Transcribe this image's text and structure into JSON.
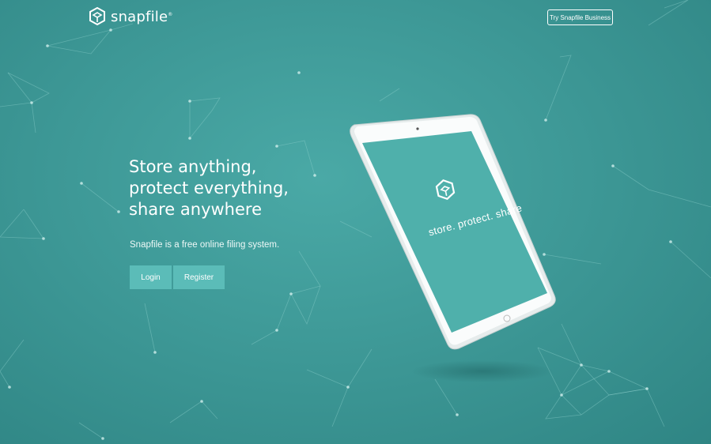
{
  "brand": {
    "name": "snapfile",
    "mark": "®"
  },
  "header": {
    "business_button": "Try Snapfile Business"
  },
  "hero": {
    "headline": [
      "Store anything,",
      "protect everything,",
      "share anywhere"
    ],
    "subtitle": "Snapfile is a free online filing system.",
    "login_label": "Login",
    "register_label": "Register"
  },
  "tablet": {
    "tagline": "store. protect. share"
  },
  "colors": {
    "background": "#3e9997",
    "button": "#5bbcb8",
    "screen": "#4fb0ab"
  }
}
